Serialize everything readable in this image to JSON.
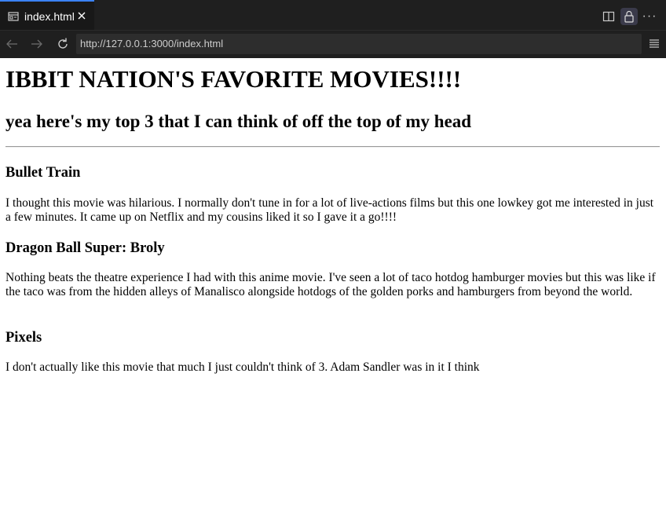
{
  "browser": {
    "tab": {
      "title": "index.html",
      "icon": "browser-preview-icon",
      "close_icon": "close-icon"
    },
    "toolbar": {
      "split_icon": "split-editor-icon",
      "lock_icon": "lock-icon",
      "more_label": "···",
      "back_icon": "arrow-left-icon",
      "forward_icon": "arrow-right-icon",
      "reload_icon": "reload-icon",
      "menu_icon": "menu-icon"
    },
    "url": "http://127.0.0.1:3000/index.html",
    "colors": {
      "chrome_bg": "#1f1f1f",
      "tab_accent": "#3b82f6",
      "url_bg": "#2d2d2d"
    }
  },
  "page": {
    "title": "IBBIT NATION'S FAVORITE MOVIES!!!!",
    "subtitle": "yea here's my top 3 that I can think of off the top of my head",
    "movies": [
      {
        "name": "Bullet Train",
        "review": "I thought this movie was hilarious. I normally don't tune in for a lot of live-actions films but this one lowkey got me interested in just a few minutes. It came up on Netflix and my cousins liked it so I gave it a go!!!!"
      },
      {
        "name": "Dragon Ball Super: Broly",
        "review": "Nothing beats the theatre experience I had with this anime movie. I've seen a lot of taco hotdog hamburger movies but this was like if the taco was from the hidden alleys of Manalisco alongside hotdogs of the golden porks and hamburgers from beyond the world."
      },
      {
        "name": "Pixels",
        "review": "I don't actually like this movie that much I just couldn't think of 3. Adam Sandler was in it I think"
      }
    ]
  }
}
